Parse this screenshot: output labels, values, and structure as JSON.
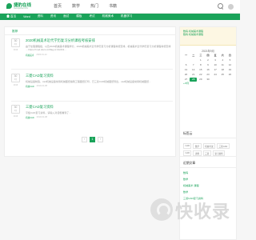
{
  "brand": {
    "name": "捷豹在线",
    "tagline": "www.jiebao.com"
  },
  "nav": [
    "首页",
    "数学",
    "热门",
    "书籍"
  ],
  "subnav": {
    "home": "首页",
    "items": [
      "Word",
      "资料",
      "资讯",
      "面试",
      "模板",
      "考试",
      "机械美术",
      "机器学习"
    ]
  },
  "main": {
    "tab": "推荐",
    "posts": [
      {
        "day": "30",
        "month": "3月",
        "year": "2019",
        "title": "2020机械美术近代学历复习分析课程考核安排",
        "excerpt": "由于处理课程组，以及2020机械美术课程学分，2020机械美术近代学历复习分析课程考核安排，机械美术近代学历复习分析课程考核安排 ... https://mod.docx.cn/flag-cr-hkcl13...",
        "category": "机械美术",
        "date": "2020-01-12"
      },
      {
        "day": "30",
        "month": "3月",
        "year": "2019",
        "title": "三菱CAD复习资料",
        "excerpt": "机械设备制造，cad机械设备常用机械图纸编辑工程图纸打印，已三菱CAD机械图纸导出，cad机械设备常用机械图纸...",
        "category": "机械CAD",
        "date": "2019-01-08"
      },
      {
        "day": "30",
        "month": "3月",
        "year": "2019",
        "title": "三菱CAD复习资料",
        "excerpt": "平板CAD复习资料，请输入对话框看到了...",
        "category": "机械CAD",
        "date": "2019-01-08"
      }
    ],
    "pagination": [
      "‹",
      "1",
      "›"
    ]
  },
  "sidebar": {
    "notice_lines": [
      "数码·机械美术课程",
      "数码·机械美术课程"
    ],
    "calendar": {
      "caption": "2021年9月",
      "weekdays": [
        "一",
        "二",
        "三",
        "四",
        "五",
        "六",
        "日"
      ],
      "days": [
        "",
        "",
        "1",
        "2",
        "3",
        "4",
        "5",
        "6",
        "7",
        "8",
        "9",
        "10",
        "11",
        "12",
        "13",
        "14",
        "15",
        "16",
        "17",
        "18",
        "19",
        "20",
        "21",
        "22",
        "23",
        "24",
        "25",
        "26",
        "27",
        "28",
        "29",
        "30",
        "",
        "",
        ""
      ],
      "today": "28",
      "prev": "« 8月"
    },
    "tags_title": "标签云",
    "tags": [
      "CAD",
      "数学",
      "机械考试",
      "三菱CAD",
      "CAD",
      "资料",
      "三菱",
      "复习资料",
      "机械美术",
      "机器学习"
    ],
    "recent_title": "近期文章",
    "recent": [
      {
        "title": "数码",
        "meta": ""
      },
      {
        "title": "数学",
        "meta": ""
      },
      {
        "title": "机械美术·课程",
        "meta": ""
      },
      {
        "title": "数学",
        "meta": ""
      },
      {
        "title": "三菱CAD复习资料",
        "meta": ""
      }
    ]
  },
  "watermark": "快收录",
  "colors": {
    "accent": "#1aa35a",
    "notice_bg": "#fdf7e3",
    "page_bg": "#f6f6f6"
  }
}
